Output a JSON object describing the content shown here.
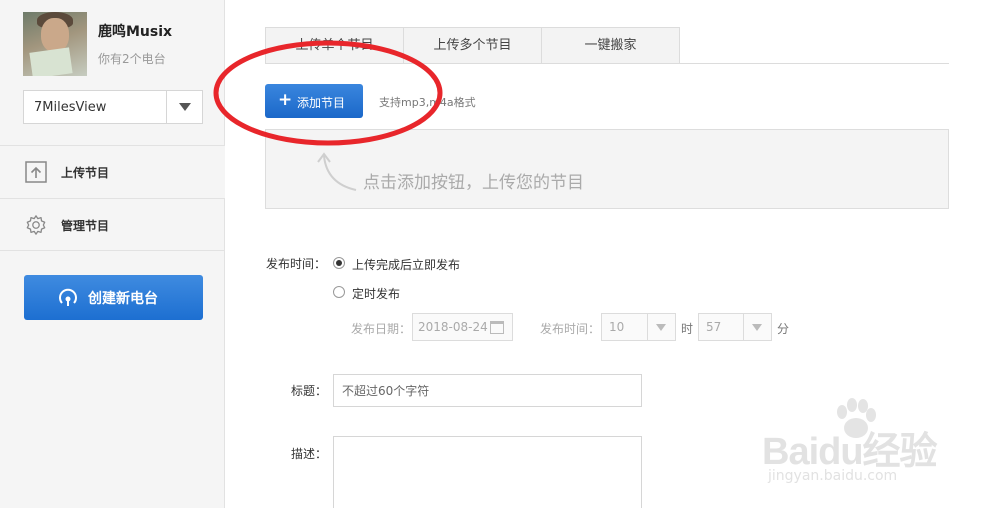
{
  "sidebar": {
    "radio_name": "鹿鸣Musix",
    "radio_count": "你有2个电台",
    "radio_select": {
      "value": "7MilesView",
      "icon": "chevron-down-icon"
    },
    "nav_items": [
      {
        "label": "上传节目",
        "icon": "upload-icon"
      },
      {
        "label": "管理节目",
        "icon": "gear-icon"
      }
    ],
    "create_button": {
      "label": "创建新电台",
      "icon": "radio-icon"
    }
  },
  "tabs": [
    {
      "label": "上传单个节目"
    },
    {
      "label": "上传多个节目"
    },
    {
      "label": "一键搬家"
    }
  ],
  "upload": {
    "add_button_icon": "plus-icon",
    "add_button_label": "添加节目",
    "format_hint": "支持mp3,m4a格式",
    "drop_hint": "点击添加按钮，上传您的节目"
  },
  "form": {
    "publish_time_label": "发布时间：",
    "publish_options": [
      {
        "label": "上传完成后立即发布",
        "checked": true
      },
      {
        "label": "定时发布",
        "checked": false
      }
    ],
    "publish_date_label": "发布日期：",
    "publish_date_value": "2018-08-24",
    "schedule_time_label": "发布时间：",
    "hour_value": "10",
    "hour_unit": "时",
    "minute_value": "57",
    "minute_unit": "分",
    "title_label": "标题：",
    "title_placeholder": "不超过60个字符",
    "description_label": "描述："
  },
  "watermark": {
    "logo": "Baidu经验",
    "url": "jingyan.baidu.com"
  },
  "colors": {
    "accent_blue": "#1d6fd1",
    "annotation_red": "#e8262b",
    "sidebar_bg": "#f5f5f5"
  }
}
